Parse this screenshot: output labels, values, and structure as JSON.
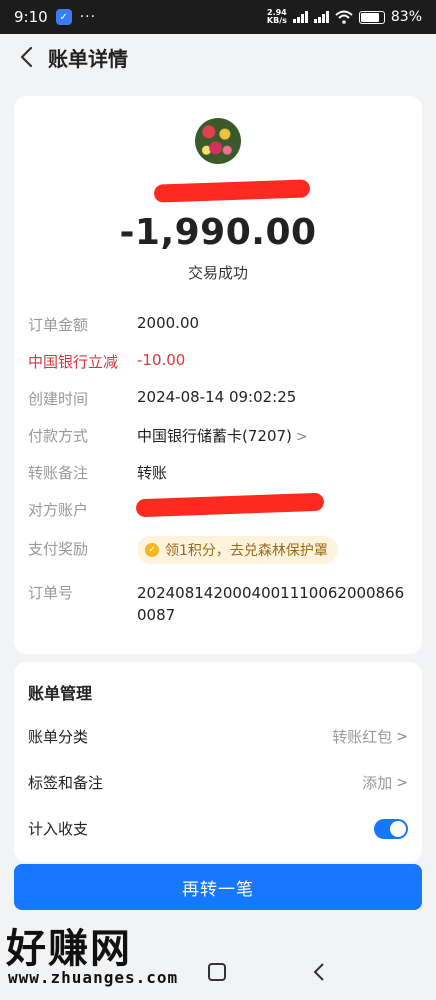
{
  "status_bar": {
    "time": "9:10",
    "more": "···",
    "net_speed_value": "2.94",
    "net_speed_unit": "KB/s",
    "battery": "83%",
    "battery_level": 0.83
  },
  "header": {
    "title": "账单详情"
  },
  "summary": {
    "amount": "-1,990.00",
    "status": "交易成功"
  },
  "details": [
    {
      "label": "订单金额",
      "value": "2000.00"
    },
    {
      "label": "中国银行立减",
      "value": "-10.00"
    },
    {
      "label": "创建时间",
      "value": "2024-08-14 09:02:25"
    },
    {
      "label": "付款方式",
      "value": "中国银行储蓄卡(7207)"
    },
    {
      "label": "转账备注",
      "value": "转账"
    },
    {
      "label": "对方账户",
      "value": ""
    },
    {
      "label": "支付奖励",
      "value": "领1积分，去兑森林保护罩"
    },
    {
      "label": "订单号",
      "value": "2024081420004001110062000866 0087"
    }
  ],
  "management": {
    "title": "账单管理",
    "category_label": "账单分类",
    "category_value": "转账红包",
    "tag_label": "标签和备注",
    "tag_value": "添加",
    "include_label": "计入收支",
    "include_on": true
  },
  "action": {
    "label": "再转一笔"
  },
  "watermark": {
    "brand": "好赚网",
    "url": "www.zhuanges.com"
  },
  "colors": {
    "accent": "#1677ff",
    "discount": "#d9363e"
  }
}
